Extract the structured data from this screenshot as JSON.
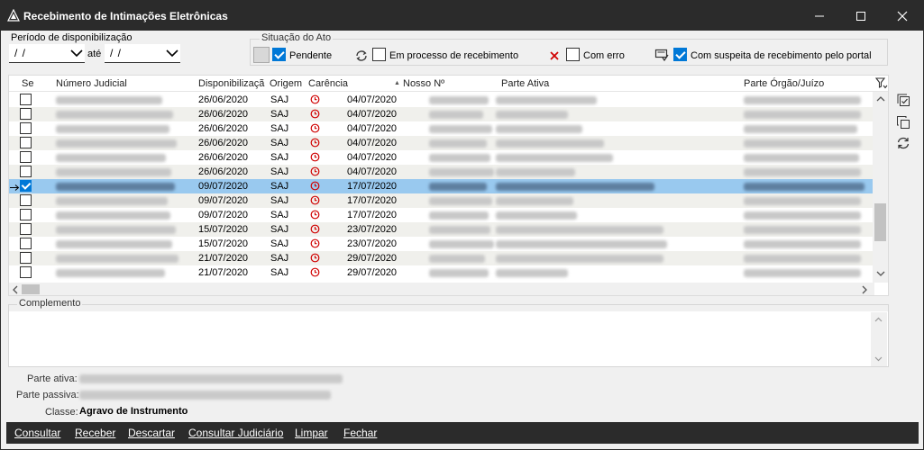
{
  "window": {
    "title": "Recebimento de Intimações Eletrônicas"
  },
  "filters": {
    "period_label": "Período de disponibilização",
    "date_from": "/ /",
    "until_label": "até",
    "date_to": "/ /"
  },
  "situacao": {
    "title": "Situação do Ato",
    "pendente": {
      "label": "Pendente",
      "checked": true
    },
    "em_processo": {
      "label": "Em processo de recebimento",
      "checked": false
    },
    "com_erro": {
      "label": "Com erro",
      "checked": false
    },
    "suspeita": {
      "label": "Com suspeita de recebimento pelo portal",
      "checked": true
    }
  },
  "grid": {
    "columns": [
      "Se",
      "Número Judicial",
      "Disponibilizaçã",
      "Origem",
      "Carência",
      "Nosso Nº",
      "Parte Ativa",
      "Parte Órgão/Juízo"
    ],
    "rows": [
      {
        "disp": "26/06/2020",
        "origem": "SAJ",
        "carencia": "04/07/2020",
        "checked": false,
        "selected": false
      },
      {
        "disp": "26/06/2020",
        "origem": "SAJ",
        "carencia": "04/07/2020",
        "checked": false,
        "selected": false
      },
      {
        "disp": "26/06/2020",
        "origem": "SAJ",
        "carencia": "04/07/2020",
        "checked": false,
        "selected": false
      },
      {
        "disp": "26/06/2020",
        "origem": "SAJ",
        "carencia": "04/07/2020",
        "checked": false,
        "selected": false
      },
      {
        "disp": "26/06/2020",
        "origem": "SAJ",
        "carencia": "04/07/2020",
        "checked": false,
        "selected": false
      },
      {
        "disp": "26/06/2020",
        "origem": "SAJ",
        "carencia": "04/07/2020",
        "checked": false,
        "selected": false
      },
      {
        "disp": "09/07/2020",
        "origem": "SAJ",
        "carencia": "17/07/2020",
        "checked": true,
        "selected": true
      },
      {
        "disp": "09/07/2020",
        "origem": "SAJ",
        "carencia": "17/07/2020",
        "checked": false,
        "selected": false
      },
      {
        "disp": "09/07/2020",
        "origem": "SAJ",
        "carencia": "17/07/2020",
        "checked": false,
        "selected": false
      },
      {
        "disp": "15/07/2020",
        "origem": "SAJ",
        "carencia": "23/07/2020",
        "checked": false,
        "selected": false
      },
      {
        "disp": "15/07/2020",
        "origem": "SAJ",
        "carencia": "23/07/2020",
        "checked": false,
        "selected": false
      },
      {
        "disp": "21/07/2020",
        "origem": "SAJ",
        "carencia": "29/07/2020",
        "checked": false,
        "selected": false
      },
      {
        "disp": "21/07/2020",
        "origem": "SAJ",
        "carencia": "29/07/2020",
        "checked": false,
        "selected": false
      }
    ]
  },
  "complemento": {
    "label": "Complemento"
  },
  "details": {
    "parte_ativa_label": "Parte ativa:",
    "parte_passiva_label": "Parte passiva:",
    "classe_label": "Classe:",
    "classe_value": "Agravo de Instrumento"
  },
  "actions": {
    "consultar": "Consultar",
    "receber": "Receber",
    "descartar": "Descartar",
    "consultar_judiciario": "Consultar Judiciário",
    "limpar": "Limpar",
    "fechar": "Fechar"
  },
  "colors": {
    "titlebar": "#2b2b2b",
    "accent": "#0078d7",
    "selected_row": "#99c9ef",
    "clock_red": "#d00000"
  }
}
